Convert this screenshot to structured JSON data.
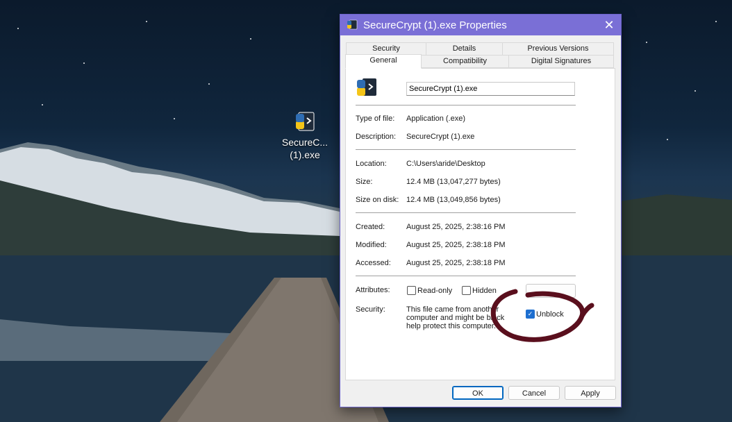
{
  "desktop": {
    "icon_label_line1": "SecureC...",
    "icon_label_line2": "(1).exe"
  },
  "dialog": {
    "title": "SecureCrypt (1).exe Properties",
    "close_glyph": "✕",
    "tabs_row1": [
      "Security",
      "Details",
      "Previous Versions"
    ],
    "tabs_row2": [
      "General",
      "Compatibility",
      "Digital Signatures"
    ],
    "active_tab": "General",
    "file_name_value": "SecureCrypt (1).exe",
    "rows": {
      "type_label": "Type of file:",
      "type_value": "Application (.exe)",
      "description_label": "Description:",
      "description_value": "SecureCrypt (1).exe",
      "location_label": "Location:",
      "location_value": "C:\\Users\\aride\\Desktop",
      "size_label": "Size:",
      "size_value": "12.4 MB (13,047,277 bytes)",
      "size_on_disk_label": "Size on disk:",
      "size_on_disk_value": "12.4 MB (13,049,856 bytes)",
      "created_label": "Created:",
      "created_value": "August 25, 2025, 2:38:16 PM",
      "modified_label": "Modified:",
      "modified_value": "August 25, 2025, 2:38:18 PM",
      "accessed_label": "Accessed:",
      "accessed_value": "August 25, 2025, 2:38:18 PM",
      "attributes_label": "Attributes:",
      "readonly_label": "Read-only",
      "hidden_label": "Hidden",
      "security_label": "Security:",
      "security_line1": "This file came from another",
      "security_line2": "computer and might be block",
      "security_line3": "help protect this computer.",
      "unblock_label": "Unblock",
      "unblock_checked": true
    },
    "buttons": {
      "ok": "OK",
      "cancel": "Cancel",
      "apply": "Apply"
    }
  },
  "annotation": {
    "color": "#5a0f1d"
  }
}
